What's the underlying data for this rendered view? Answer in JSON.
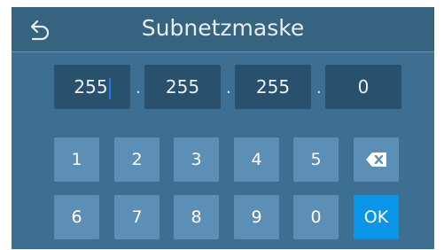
{
  "header": {
    "title": "Subnetzmaske",
    "back_icon": "back-arrow-icon"
  },
  "address": {
    "octets": [
      "255",
      "255",
      "255",
      "0"
    ],
    "separator": "."
  },
  "keypad": {
    "row1": [
      "1",
      "2",
      "3",
      "4",
      "5"
    ],
    "row2": [
      "6",
      "7",
      "8",
      "9",
      "0"
    ],
    "backspace_icon": "backspace-icon",
    "ok_label": "OK"
  },
  "colors": {
    "background": "#3c6f92",
    "header": "#36637f",
    "field": "#29506c",
    "key": "#5b8fb6",
    "ok": "#0a96e8",
    "caret": "#1f7fe3"
  }
}
